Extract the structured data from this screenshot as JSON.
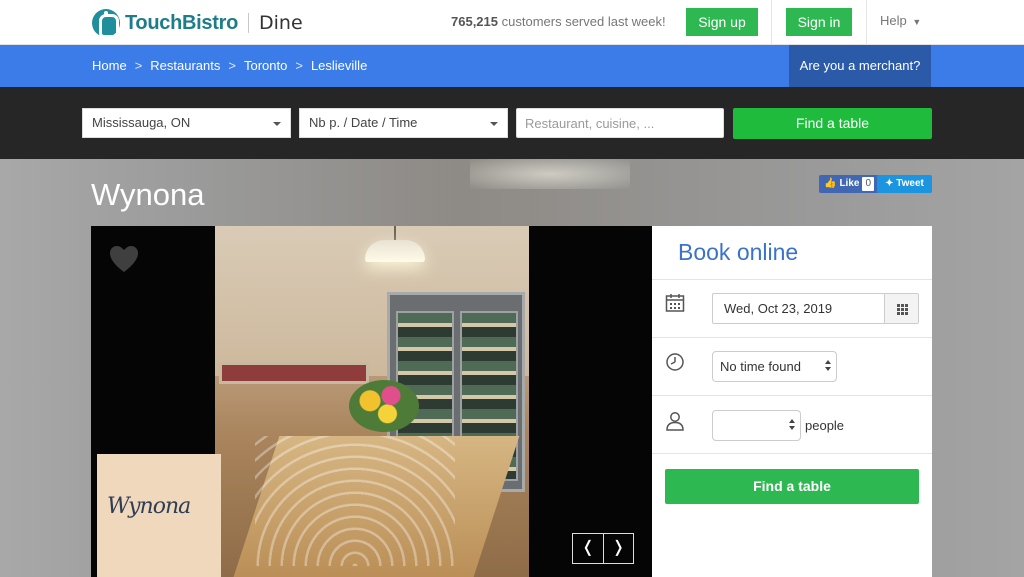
{
  "header": {
    "brand": "TouchBistro",
    "product": "Dine",
    "customers_count": "765,215",
    "customers_text": "customers served last week!",
    "signup_label": "Sign up",
    "signin_label": "Sign in",
    "help_label": "Help"
  },
  "breadcrumb": {
    "items": [
      "Home",
      "Restaurants",
      "Toronto",
      "Leslieville"
    ],
    "separator": ">",
    "merchant_label": "Are you a merchant?"
  },
  "search": {
    "location": "Mississauga, ON",
    "party_date_time": "Nb p. / Date / Time",
    "placeholder": "Restaurant, cuisine, ...",
    "find_label": "Find a table"
  },
  "restaurant": {
    "name": "Wynona",
    "like_label": "Like",
    "like_count": "0",
    "tweet_label": "Tweet",
    "logo_text": "Wynona"
  },
  "gallery": {
    "prev_label": "❬",
    "next_label": "❭"
  },
  "booking": {
    "title": "Book online",
    "date": "Wed, Oct 23, 2019",
    "time": "No time found",
    "people_value": "",
    "people_label": "people",
    "find_label": "Find a table"
  },
  "colors": {
    "brand_teal": "#1e7d89",
    "green": "#2eb852",
    "blue_bar": "#3b7ce8",
    "merchant_bar": "#2a5aa8",
    "book_title": "#3b73c9"
  }
}
